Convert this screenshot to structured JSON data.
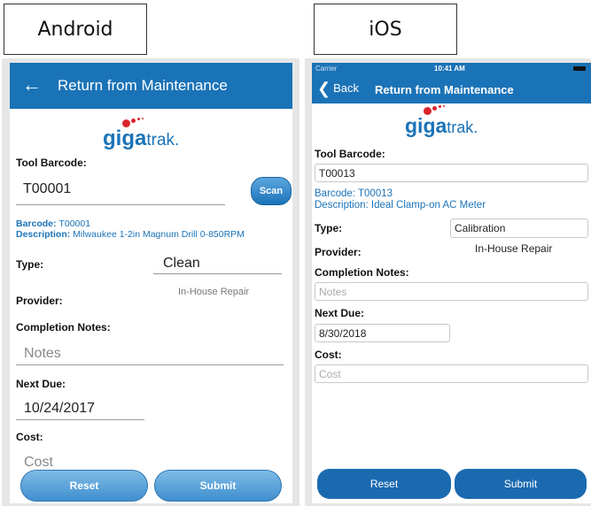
{
  "labels": {
    "android": "Android",
    "ios": "iOS"
  },
  "android": {
    "back_icon": "arrow-left-icon",
    "title": "Return from Maintenance",
    "logo": {
      "bold": "giga",
      "light": "trak."
    },
    "tool_barcode_label": "Tool Barcode:",
    "tool_barcode_value": "T00001",
    "scan_label": "Scan",
    "barcode_key": "Barcode:",
    "barcode_value": "T00001",
    "description_key": "Description:",
    "description_value": "Milwaukee 1-2in Magnum Drill 0-850RPM",
    "type_label": "Type:",
    "type_value": "Clean",
    "provider_label": "Provider:",
    "provider_value": "In-House Repair",
    "completion_notes_label": "Completion Notes:",
    "notes_placeholder": "Notes",
    "next_due_label": "Next Due:",
    "next_due_value": "10/24/2017",
    "cost_label": "Cost:",
    "cost_placeholder": "Cost",
    "reset_label": "Reset",
    "submit_label": "Submit"
  },
  "ios": {
    "carrier": "Carrier",
    "time": "10:41 AM",
    "back_label": "Back",
    "title": "Return from Maintenance",
    "logo": {
      "bold": "giga",
      "light": "trak."
    },
    "tool_barcode_label": "Tool Barcode:",
    "tool_barcode_value": "T00013",
    "barcode_line": "Barcode: T00013",
    "description_line": "Description: Ideal Clamp-on AC Meter",
    "type_label": "Type:",
    "type_value": "Calibration",
    "provider_label": "Provider:",
    "provider_value": "In-House Repair",
    "completion_notes_label": "Completion Notes:",
    "notes_placeholder": "Notes",
    "next_due_label": "Next Due:",
    "next_due_value": "8/30/2018",
    "cost_label": "Cost:",
    "cost_placeholder": "Cost",
    "reset_label": "Reset",
    "submit_label": "Submit"
  },
  "colors": {
    "brand_blue": "#1b73b7",
    "logo_dot_red": "#d9262b"
  }
}
